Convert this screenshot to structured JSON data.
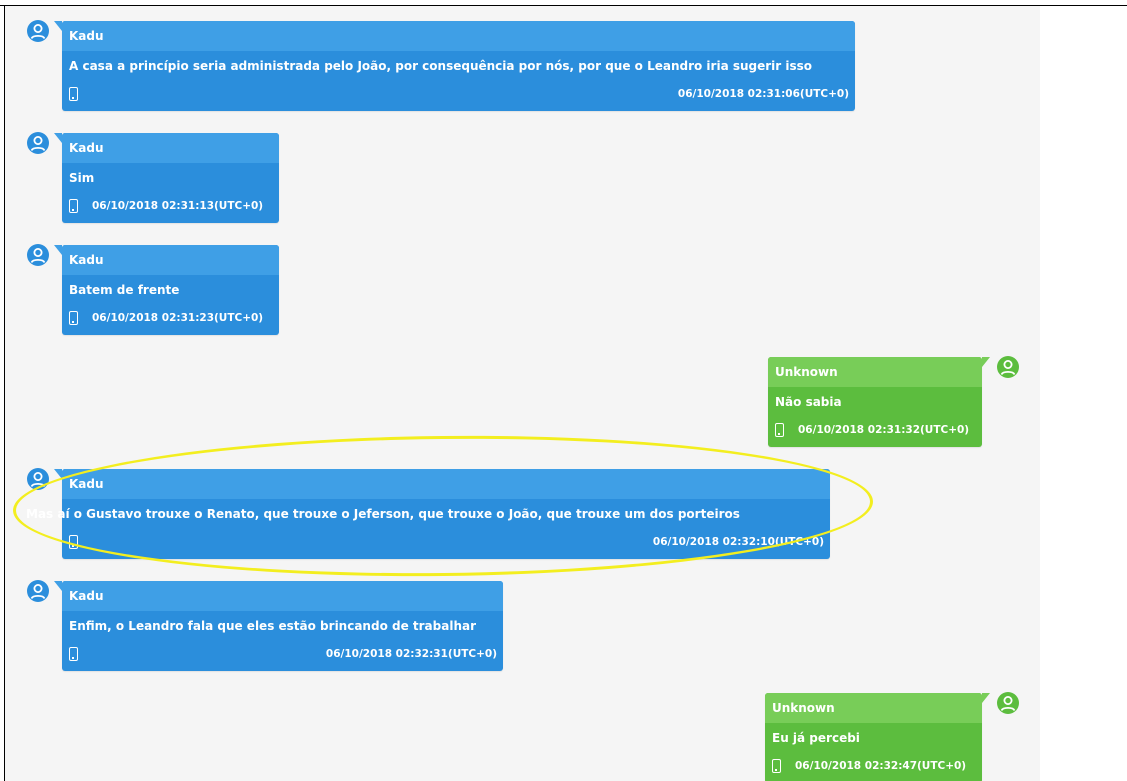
{
  "colors": {
    "incoming_bubble": "#2b8edc",
    "incoming_header": "#3f9fe6",
    "outgoing_bubble": "#5cbd3e",
    "outgoing_header": "#78cd58",
    "highlight": "#f3ee1f",
    "background": "#f5f5f5"
  },
  "messages": [
    {
      "sender": "Kadu",
      "direction": "incoming",
      "text": "A casa a princípio seria administrada pelo João, por consequência por nós, por que o Leandro iria sugerir isso",
      "timestamp": "06/10/2018 02:31:06(UTC+0)",
      "icon": "mobile-device-icon"
    },
    {
      "sender": "Kadu",
      "direction": "incoming",
      "text": "Sim",
      "timestamp": "06/10/2018 02:31:13(UTC+0)",
      "icon": "mobile-device-icon"
    },
    {
      "sender": "Kadu",
      "direction": "incoming",
      "text": "Batem de frente",
      "timestamp": "06/10/2018 02:31:23(UTC+0)",
      "icon": "mobile-device-icon"
    },
    {
      "sender": "Unknown",
      "direction": "outgoing",
      "text": "Não sabia",
      "timestamp": "06/10/2018 02:31:32(UTC+0)",
      "icon": "mobile-device-icon"
    },
    {
      "sender": "Kadu",
      "direction": "incoming",
      "text": "Mas aí o Gustavo trouxe o Renato, que trouxe o Jeferson, que trouxe o João, que trouxe um dos porteiros",
      "timestamp": "06/10/2018 02:32:10(UTC+0)",
      "icon": "mobile-device-icon",
      "highlighted": true
    },
    {
      "sender": "Kadu",
      "direction": "incoming",
      "text": "Enfim, o Leandro fala que eles estão brincando de trabalhar",
      "timestamp": "06/10/2018 02:32:31(UTC+0)",
      "icon": "mobile-device-icon"
    },
    {
      "sender": "Unknown",
      "direction": "outgoing",
      "text": "Eu já percebi",
      "timestamp": "06/10/2018 02:32:47(UTC+0)",
      "icon": "mobile-device-icon"
    }
  ]
}
